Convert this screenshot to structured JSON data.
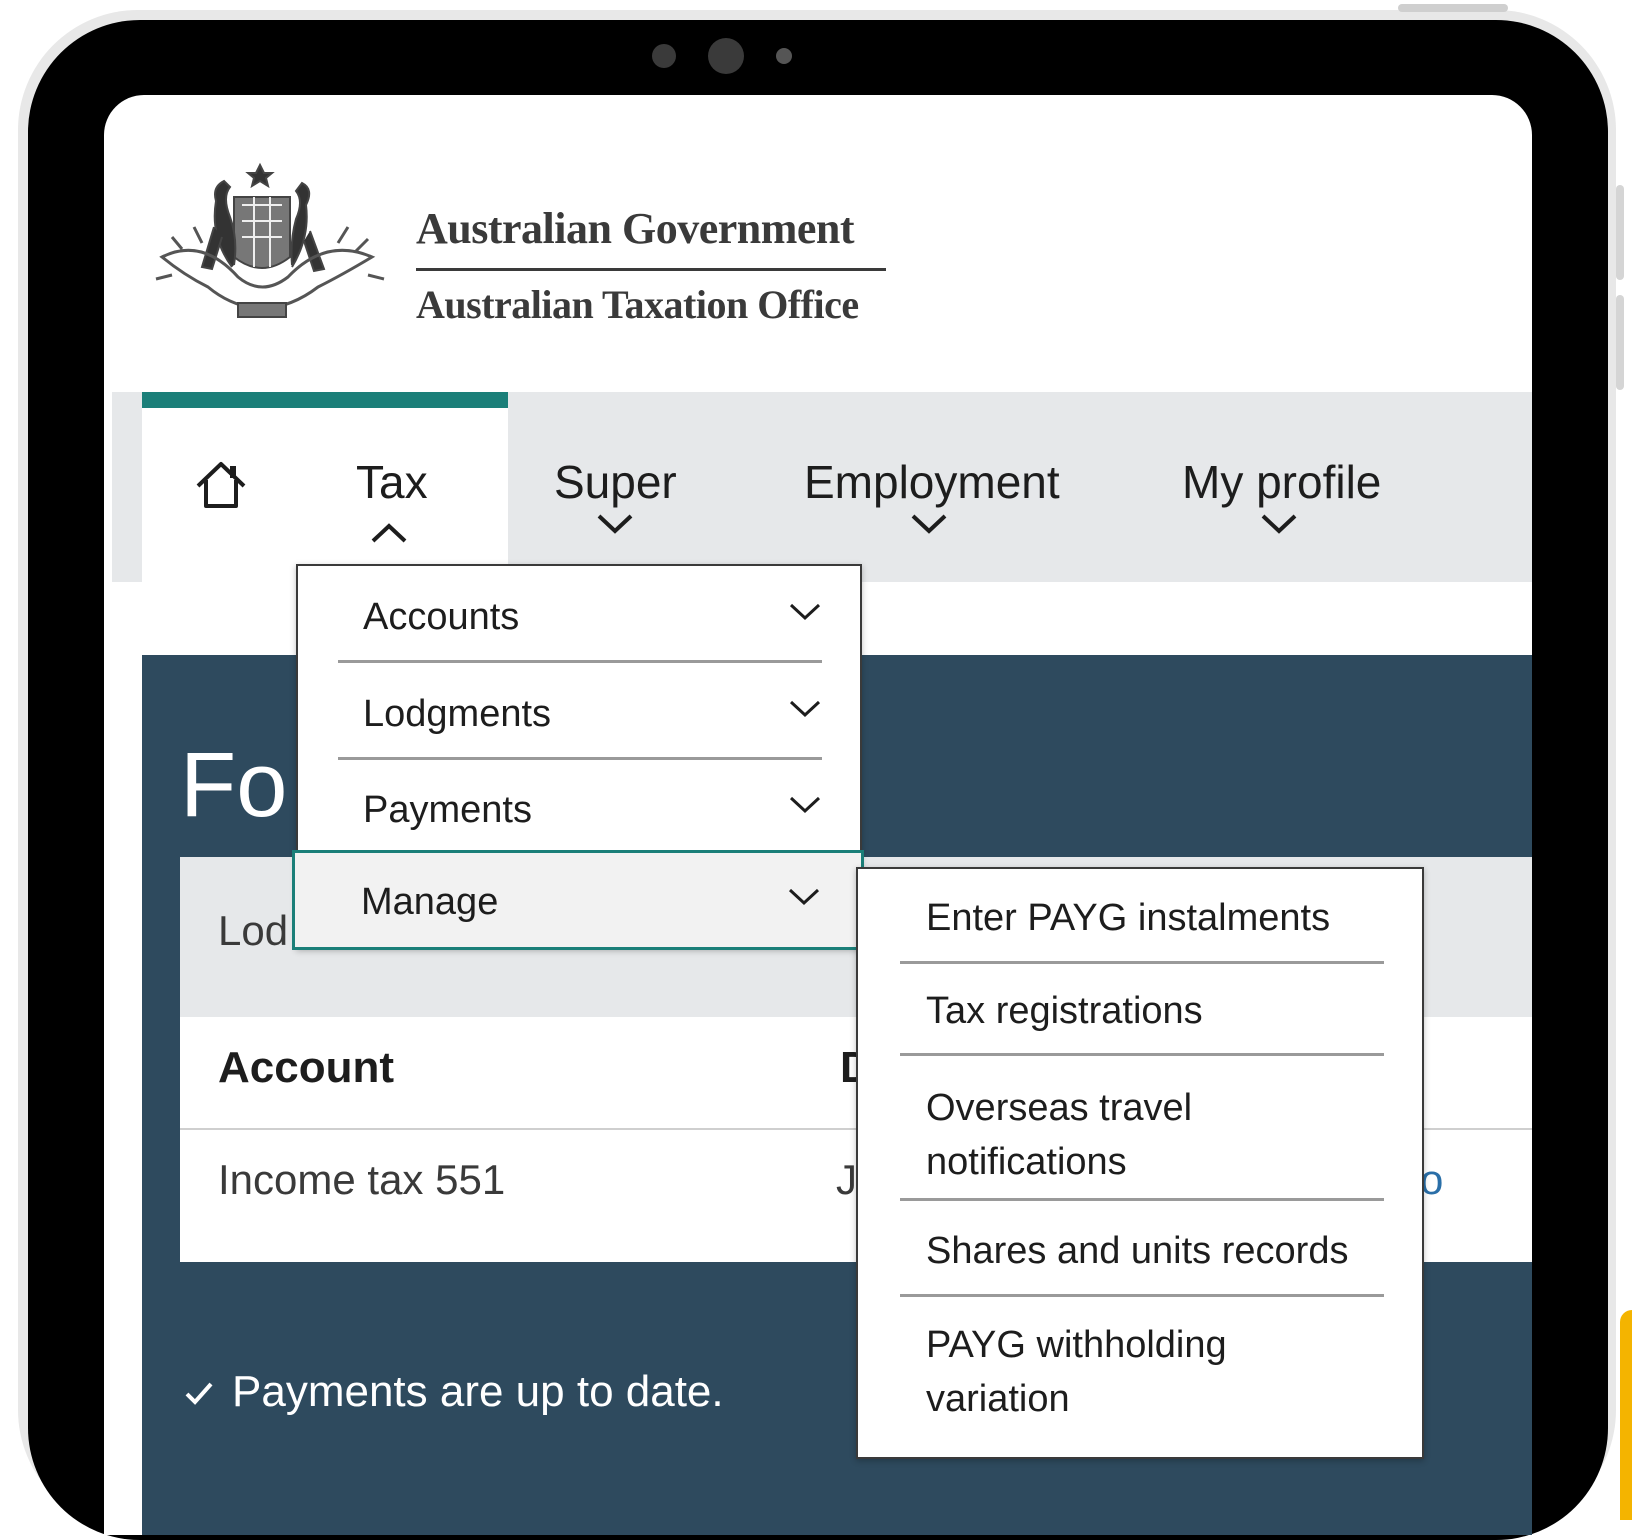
{
  "header": {
    "government": "Australian Government",
    "office": "Australian Taxation Office"
  },
  "nav": {
    "items": [
      {
        "label": "Tax",
        "expanded": true
      },
      {
        "label": "Super"
      },
      {
        "label": "Employment"
      },
      {
        "label": "My profile"
      }
    ],
    "active_accent": "#1b7f79"
  },
  "tax_menu": {
    "items": [
      {
        "label": "Accounts"
      },
      {
        "label": "Lodgments"
      },
      {
        "label": "Payments"
      },
      {
        "label": "Manage",
        "highlighted": true
      }
    ]
  },
  "manage_menu": {
    "items": [
      {
        "label": "Enter PAYG instalments"
      },
      {
        "label": "Tax registrations"
      },
      {
        "label": "Overseas travel notifications"
      },
      {
        "label": "Shares and units records"
      },
      {
        "label": "PAYG withholding variation"
      }
    ]
  },
  "content": {
    "title_partial": "Fo",
    "card_partial": "Lod",
    "columns": {
      "account": "Account",
      "second_partial": "D"
    },
    "row": {
      "account": "Income tax 551",
      "second_partial": "J",
      "third_partial": "o"
    },
    "status": "Payments are up to date.",
    "panel_color": "#2e4a5e"
  }
}
